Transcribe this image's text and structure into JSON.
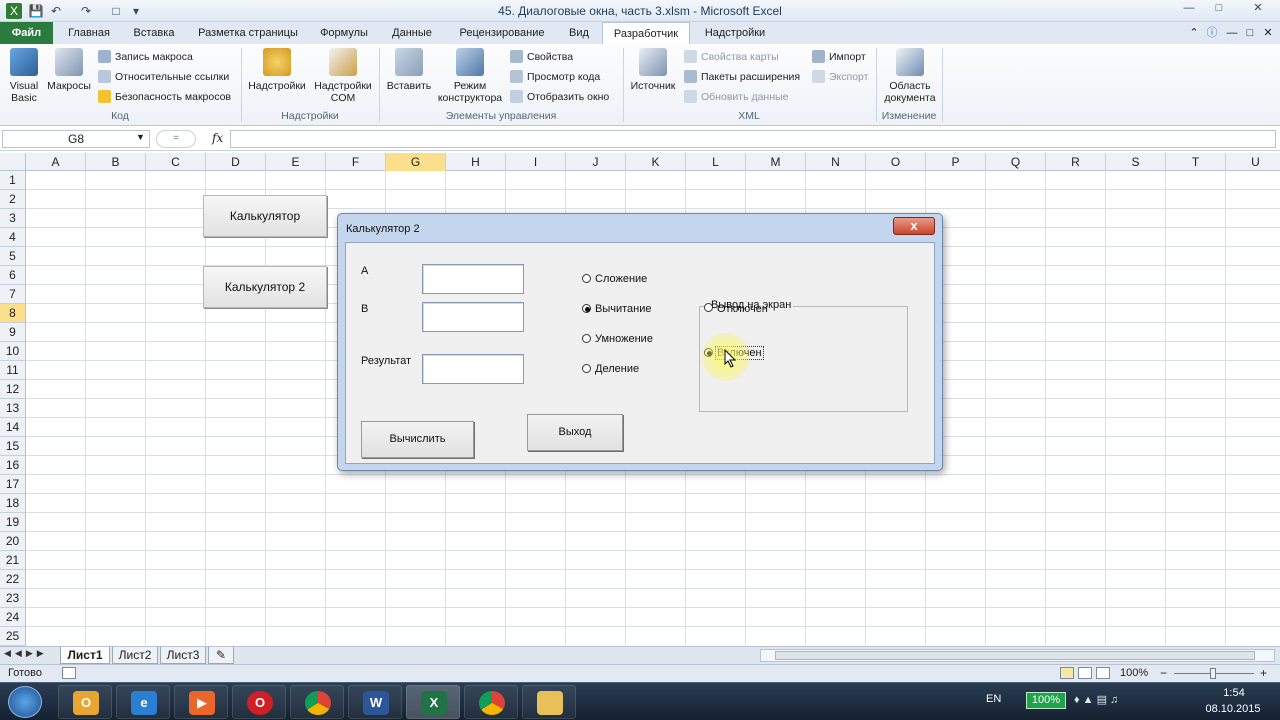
{
  "window": {
    "title": "45. Диалоговые окна, часть 3.xlsm  -  Microsoft Excel"
  },
  "ribbon_tabs": [
    "Файл",
    "Главная",
    "Вставка",
    "Разметка страницы",
    "Формулы",
    "Данные",
    "Рецензирование",
    "Вид",
    "Разработчик",
    "Надстройки"
  ],
  "ribbon": {
    "code": {
      "visual_basic": "Visual Basic",
      "macros": "Макросы",
      "record": "Запись макроса",
      "relative": "Относительные ссылки",
      "security": "Безопасность макросов",
      "group": "Код"
    },
    "addins": {
      "addins": "Надстройки",
      "com": "Надстройки COM",
      "group": "Надстройки"
    },
    "controls": {
      "insert": "Вставить",
      "design": "Режим конструктора",
      "properties": "Свойства",
      "view_code": "Просмотр кода",
      "run_dialog": "Отобразить окно",
      "group": "Элементы управления"
    },
    "xml": {
      "source": "Источник",
      "map_props": "Свойства карты",
      "packs": "Пакеты расширения",
      "refresh": "Обновить данные",
      "import": "Импорт",
      "export": "Экспорт",
      "group": "XML"
    },
    "modify": {
      "doc_panel": "Область документа",
      "group": "Изменение"
    }
  },
  "formula_bar": {
    "name_box": "G8",
    "fx": "fx",
    "value": ""
  },
  "columns": [
    "A",
    "B",
    "C",
    "D",
    "E",
    "F",
    "G",
    "H",
    "I",
    "J",
    "K",
    "L",
    "M",
    "N",
    "O",
    "P",
    "Q",
    "R",
    "S",
    "T",
    "U"
  ],
  "rows": [
    "1",
    "2",
    "3",
    "4",
    "5",
    "6",
    "7",
    "8",
    "9",
    "10",
    "11",
    "12",
    "13",
    "14",
    "15",
    "16",
    "17",
    "18",
    "19",
    "20",
    "21",
    "22",
    "23",
    "24",
    "25"
  ],
  "selected": {
    "column": "G",
    "row": "8"
  },
  "sheet_buttons": {
    "calc1": "Калькулятор",
    "calc2": "Калькулятор 2"
  },
  "dialog": {
    "title": "Калькулятор 2",
    "close": "x",
    "label_a": "A",
    "label_b": "B",
    "label_result": "Результат",
    "input_a": "",
    "input_b": "",
    "input_result": "",
    "ops": [
      {
        "label": "Сложение",
        "checked": false
      },
      {
        "label": "Вычитание",
        "checked": true
      },
      {
        "label": "Умножение",
        "checked": false
      },
      {
        "label": "Деление",
        "checked": false
      }
    ],
    "frame_title": "Вывод на экран",
    "display": [
      {
        "label": "Отключен",
        "checked": false
      },
      {
        "label": "Включен",
        "checked": true
      }
    ],
    "compute_button": "Вычислить",
    "exit_button": "Выход"
  },
  "sheet_tabs": [
    "Лист1",
    "Лист2",
    "Лист3"
  ],
  "status": {
    "ready": "Готово",
    "zoom": "100%"
  },
  "taskbar": {
    "lang": "EN",
    "battery": "100%",
    "time": "1:54",
    "date": "08.10.2015"
  }
}
